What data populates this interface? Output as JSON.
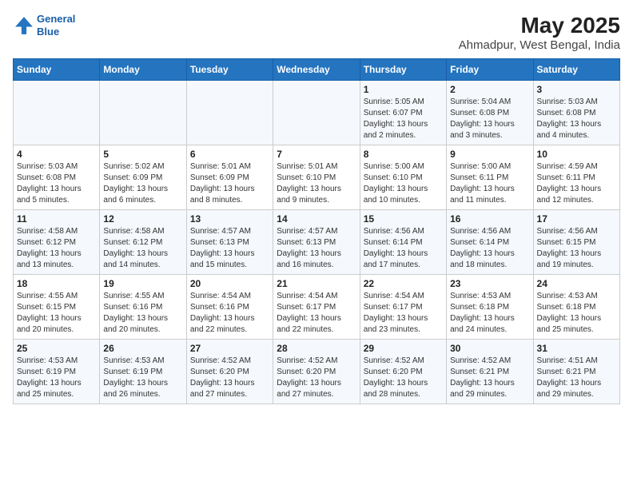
{
  "header": {
    "logo_line1": "General",
    "logo_line2": "Blue",
    "main_title": "May 2025",
    "sub_title": "Ahmadpur, West Bengal, India"
  },
  "days_of_week": [
    "Sunday",
    "Monday",
    "Tuesday",
    "Wednesday",
    "Thursday",
    "Friday",
    "Saturday"
  ],
  "weeks": [
    [
      {
        "day": "",
        "info": ""
      },
      {
        "day": "",
        "info": ""
      },
      {
        "day": "",
        "info": ""
      },
      {
        "day": "",
        "info": ""
      },
      {
        "day": "1",
        "info": "Sunrise: 5:05 AM\nSunset: 6:07 PM\nDaylight: 13 hours\nand 2 minutes."
      },
      {
        "day": "2",
        "info": "Sunrise: 5:04 AM\nSunset: 6:08 PM\nDaylight: 13 hours\nand 3 minutes."
      },
      {
        "day": "3",
        "info": "Sunrise: 5:03 AM\nSunset: 6:08 PM\nDaylight: 13 hours\nand 4 minutes."
      }
    ],
    [
      {
        "day": "4",
        "info": "Sunrise: 5:03 AM\nSunset: 6:08 PM\nDaylight: 13 hours\nand 5 minutes."
      },
      {
        "day": "5",
        "info": "Sunrise: 5:02 AM\nSunset: 6:09 PM\nDaylight: 13 hours\nand 6 minutes."
      },
      {
        "day": "6",
        "info": "Sunrise: 5:01 AM\nSunset: 6:09 PM\nDaylight: 13 hours\nand 8 minutes."
      },
      {
        "day": "7",
        "info": "Sunrise: 5:01 AM\nSunset: 6:10 PM\nDaylight: 13 hours\nand 9 minutes."
      },
      {
        "day": "8",
        "info": "Sunrise: 5:00 AM\nSunset: 6:10 PM\nDaylight: 13 hours\nand 10 minutes."
      },
      {
        "day": "9",
        "info": "Sunrise: 5:00 AM\nSunset: 6:11 PM\nDaylight: 13 hours\nand 11 minutes."
      },
      {
        "day": "10",
        "info": "Sunrise: 4:59 AM\nSunset: 6:11 PM\nDaylight: 13 hours\nand 12 minutes."
      }
    ],
    [
      {
        "day": "11",
        "info": "Sunrise: 4:58 AM\nSunset: 6:12 PM\nDaylight: 13 hours\nand 13 minutes."
      },
      {
        "day": "12",
        "info": "Sunrise: 4:58 AM\nSunset: 6:12 PM\nDaylight: 13 hours\nand 14 minutes."
      },
      {
        "day": "13",
        "info": "Sunrise: 4:57 AM\nSunset: 6:13 PM\nDaylight: 13 hours\nand 15 minutes."
      },
      {
        "day": "14",
        "info": "Sunrise: 4:57 AM\nSunset: 6:13 PM\nDaylight: 13 hours\nand 16 minutes."
      },
      {
        "day": "15",
        "info": "Sunrise: 4:56 AM\nSunset: 6:14 PM\nDaylight: 13 hours\nand 17 minutes."
      },
      {
        "day": "16",
        "info": "Sunrise: 4:56 AM\nSunset: 6:14 PM\nDaylight: 13 hours\nand 18 minutes."
      },
      {
        "day": "17",
        "info": "Sunrise: 4:56 AM\nSunset: 6:15 PM\nDaylight: 13 hours\nand 19 minutes."
      }
    ],
    [
      {
        "day": "18",
        "info": "Sunrise: 4:55 AM\nSunset: 6:15 PM\nDaylight: 13 hours\nand 20 minutes."
      },
      {
        "day": "19",
        "info": "Sunrise: 4:55 AM\nSunset: 6:16 PM\nDaylight: 13 hours\nand 20 minutes."
      },
      {
        "day": "20",
        "info": "Sunrise: 4:54 AM\nSunset: 6:16 PM\nDaylight: 13 hours\nand 22 minutes."
      },
      {
        "day": "21",
        "info": "Sunrise: 4:54 AM\nSunset: 6:17 PM\nDaylight: 13 hours\nand 22 minutes."
      },
      {
        "day": "22",
        "info": "Sunrise: 4:54 AM\nSunset: 6:17 PM\nDaylight: 13 hours\nand 23 minutes."
      },
      {
        "day": "23",
        "info": "Sunrise: 4:53 AM\nSunset: 6:18 PM\nDaylight: 13 hours\nand 24 minutes."
      },
      {
        "day": "24",
        "info": "Sunrise: 4:53 AM\nSunset: 6:18 PM\nDaylight: 13 hours\nand 25 minutes."
      }
    ],
    [
      {
        "day": "25",
        "info": "Sunrise: 4:53 AM\nSunset: 6:19 PM\nDaylight: 13 hours\nand 25 minutes."
      },
      {
        "day": "26",
        "info": "Sunrise: 4:53 AM\nSunset: 6:19 PM\nDaylight: 13 hours\nand 26 minutes."
      },
      {
        "day": "27",
        "info": "Sunrise: 4:52 AM\nSunset: 6:20 PM\nDaylight: 13 hours\nand 27 minutes."
      },
      {
        "day": "28",
        "info": "Sunrise: 4:52 AM\nSunset: 6:20 PM\nDaylight: 13 hours\nand 27 minutes."
      },
      {
        "day": "29",
        "info": "Sunrise: 4:52 AM\nSunset: 6:20 PM\nDaylight: 13 hours\nand 28 minutes."
      },
      {
        "day": "30",
        "info": "Sunrise: 4:52 AM\nSunset: 6:21 PM\nDaylight: 13 hours\nand 29 minutes."
      },
      {
        "day": "31",
        "info": "Sunrise: 4:51 AM\nSunset: 6:21 PM\nDaylight: 13 hours\nand 29 minutes."
      }
    ]
  ]
}
